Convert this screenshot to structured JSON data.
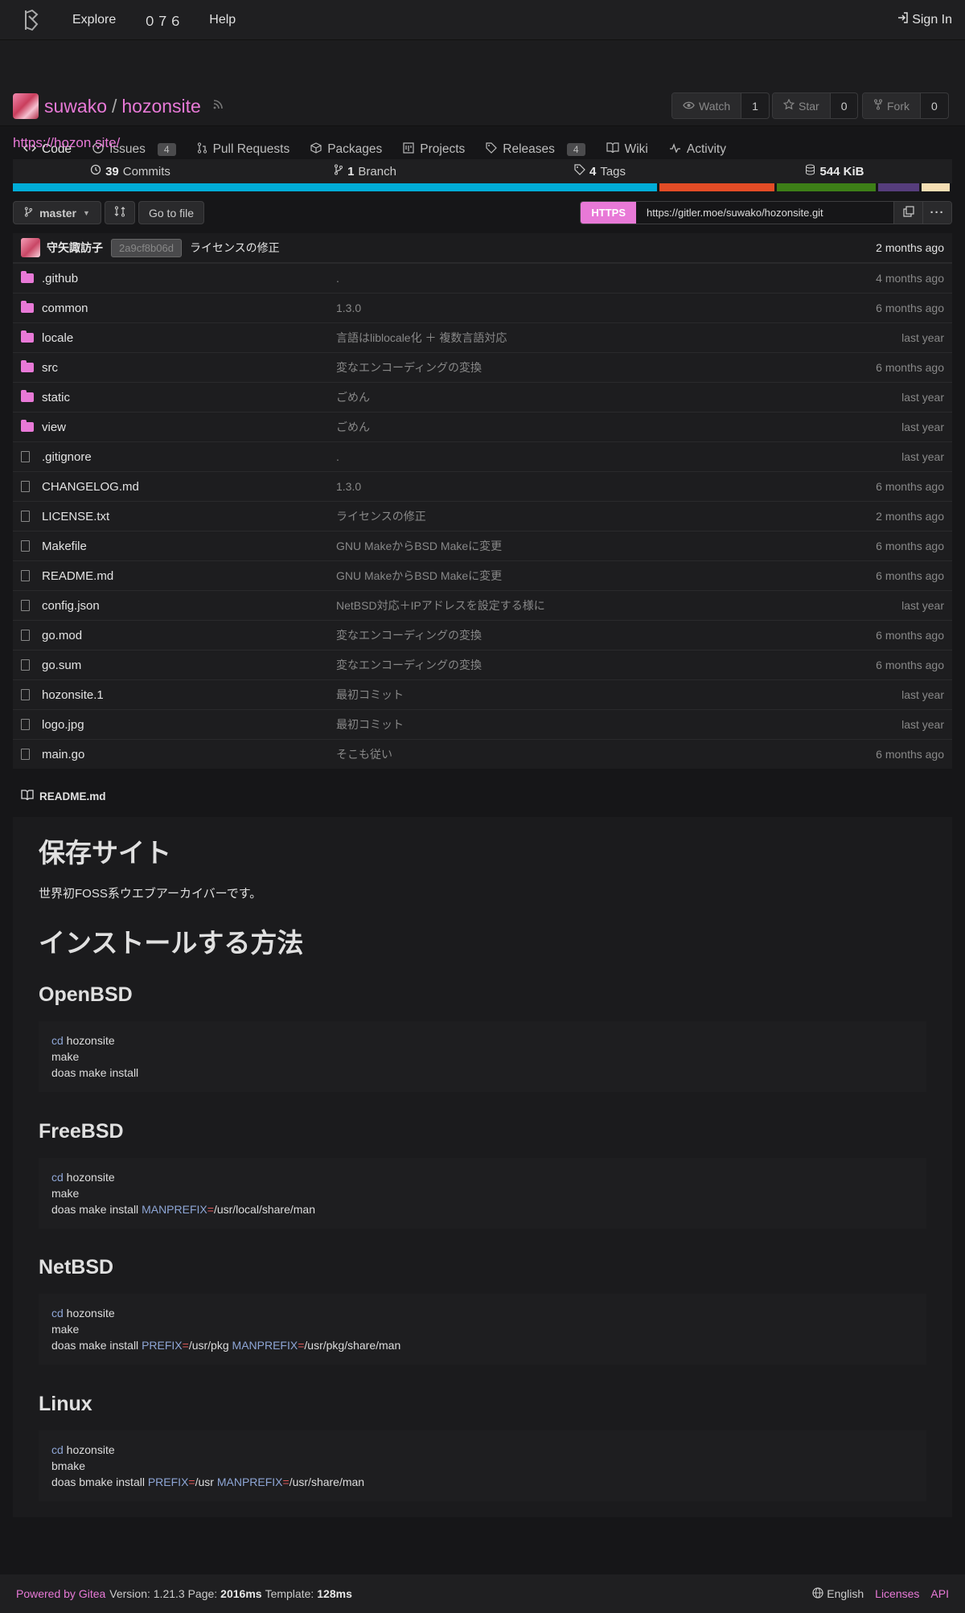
{
  "nav": {
    "items": [
      "Explore",
      "０７６",
      "Help"
    ],
    "sign_in": "Sign In"
  },
  "repo": {
    "owner": "suwako",
    "name": "hozonsite",
    "watch_label": "Watch",
    "watch_count": "1",
    "star_label": "Star",
    "star_count": "0",
    "fork_label": "Fork",
    "fork_count": "0",
    "website": "https://hozon.site/"
  },
  "tabs": [
    {
      "label": "Code",
      "icon": "code-icon"
    },
    {
      "label": "Issues",
      "badge": "4",
      "icon": "issue-icon"
    },
    {
      "label": "Pull Requests",
      "icon": "pull-request-icon"
    },
    {
      "label": "Packages",
      "icon": "package-icon"
    },
    {
      "label": "Projects",
      "icon": "project-icon"
    },
    {
      "label": "Releases",
      "badge": "4",
      "icon": "tag-icon"
    },
    {
      "label": "Wiki",
      "icon": "book-icon"
    },
    {
      "label": "Activity",
      "icon": "pulse-icon"
    }
  ],
  "stats": {
    "commits_count": "39",
    "commits_label": "Commits",
    "branch_count": "1",
    "branch_label": "Branch",
    "tags_count": "4",
    "tags_label": "Tags",
    "size": "544 KiB"
  },
  "language_colors": [
    {
      "color": "#00acd7",
      "fraction": 0.695
    },
    {
      "color": "#e34c26",
      "fraction": 0.124
    },
    {
      "color": "#3d7f17",
      "fraction": 0.106
    },
    {
      "color": "#563d7c",
      "fraction": 0.045
    },
    {
      "color": "#f5deb3",
      "fraction": 0.03
    }
  ],
  "toolbar": {
    "branch": "master",
    "go_to_file": "Go to file",
    "clone_protocol": "HTTPS",
    "clone_url": "https://gitler.moe/suwako/hozonsite.git"
  },
  "latest_commit": {
    "author": "守矢諏訪子",
    "sha": "2a9cf8b06d",
    "message": "ライセンスの修正",
    "age": "2 months ago"
  },
  "files": [
    {
      "name": ".github",
      "type": "dir",
      "message": ".",
      "age": "4 months ago"
    },
    {
      "name": "common",
      "type": "dir",
      "message": "1.3.0",
      "age": "6 months ago"
    },
    {
      "name": "locale",
      "type": "dir",
      "message": "言語はliblocale化 ＋ 複数言語対応",
      "age": "last year"
    },
    {
      "name": "src",
      "type": "dir",
      "message": "変なエンコーディングの変換",
      "age": "6 months ago"
    },
    {
      "name": "static",
      "type": "dir",
      "message": "ごめん",
      "age": "last year"
    },
    {
      "name": "view",
      "type": "dir",
      "message": "ごめん",
      "age": "last year"
    },
    {
      "name": ".gitignore",
      "type": "file",
      "message": ".",
      "age": "last year"
    },
    {
      "name": "CHANGELOG.md",
      "type": "file",
      "message": "1.3.0",
      "age": "6 months ago"
    },
    {
      "name": "LICENSE.txt",
      "type": "file",
      "message": "ライセンスの修正",
      "age": "2 months ago"
    },
    {
      "name": "Makefile",
      "type": "file",
      "message": "GNU MakeからBSD Makeに変更",
      "age": "6 months ago"
    },
    {
      "name": "README.md",
      "type": "file",
      "message": "GNU MakeからBSD Makeに変更",
      "age": "6 months ago"
    },
    {
      "name": "config.json",
      "type": "file",
      "message": "NetBSD対応＋IPアドレスを設定する様に",
      "age": "last year"
    },
    {
      "name": "go.mod",
      "type": "file",
      "message": "変なエンコーディングの変換",
      "age": "6 months ago"
    },
    {
      "name": "go.sum",
      "type": "file",
      "message": "変なエンコーディングの変換",
      "age": "6 months ago"
    },
    {
      "name": "hozonsite.1",
      "type": "file",
      "message": "最初コミット",
      "age": "last year"
    },
    {
      "name": "logo.jpg",
      "type": "file",
      "message": "最初コミット",
      "age": "last year"
    },
    {
      "name": "main.go",
      "type": "file",
      "message": "そこも従い",
      "age": "6 months ago"
    }
  ],
  "readme": {
    "filename": "README.md",
    "h1": "保存サイト",
    "intro": "世界初FOSS系ウエブアーカイバーです。",
    "install_heading": "インストールする方法",
    "sections": [
      {
        "heading": "OpenBSD",
        "lines": [
          [
            {
              "t": "cd",
              "c": "kw"
            },
            {
              "t": " hozonsite"
            }
          ],
          [
            {
              "t": "make"
            }
          ],
          [
            {
              "t": "doas make install"
            }
          ]
        ]
      },
      {
        "heading": "FreeBSD",
        "lines": [
          [
            {
              "t": "cd",
              "c": "kw"
            },
            {
              "t": " hozonsite"
            }
          ],
          [
            {
              "t": "make"
            }
          ],
          [
            {
              "t": "doas make install "
            },
            {
              "t": "MANPREFIX",
              "c": "kw"
            },
            {
              "t": "=",
              "c": "eq"
            },
            {
              "t": "/usr/local/share/man"
            }
          ]
        ]
      },
      {
        "heading": "NetBSD",
        "lines": [
          [
            {
              "t": "cd",
              "c": "kw"
            },
            {
              "t": " hozonsite"
            }
          ],
          [
            {
              "t": "make"
            }
          ],
          [
            {
              "t": "doas make install "
            },
            {
              "t": "PREFIX",
              "c": "kw"
            },
            {
              "t": "=",
              "c": "eq"
            },
            {
              "t": "/usr/pkg "
            },
            {
              "t": "MANPREFIX",
              "c": "kw"
            },
            {
              "t": "=",
              "c": "eq"
            },
            {
              "t": "/usr/pkg/share/man"
            }
          ]
        ]
      },
      {
        "heading": "Linux",
        "lines": [
          [
            {
              "t": "cd",
              "c": "kw"
            },
            {
              "t": " hozonsite"
            }
          ],
          [
            {
              "t": "bmake"
            }
          ],
          [
            {
              "t": "doas bmake install "
            },
            {
              "t": "PREFIX",
              "c": "kw"
            },
            {
              "t": "=",
              "c": "eq"
            },
            {
              "t": "/usr "
            },
            {
              "t": "MANPREFIX",
              "c": "kw"
            },
            {
              "t": "=",
              "c": "eq"
            },
            {
              "t": "/usr/share/man"
            }
          ]
        ]
      }
    ]
  },
  "footer": {
    "powered": "Powered by Gitea",
    "version_label": "Version: 1.21.3 Page:",
    "page_time": "2016ms",
    "template_label": "Template:",
    "template_time": "128ms",
    "language": "English",
    "licenses": "Licenses",
    "api": "API"
  }
}
